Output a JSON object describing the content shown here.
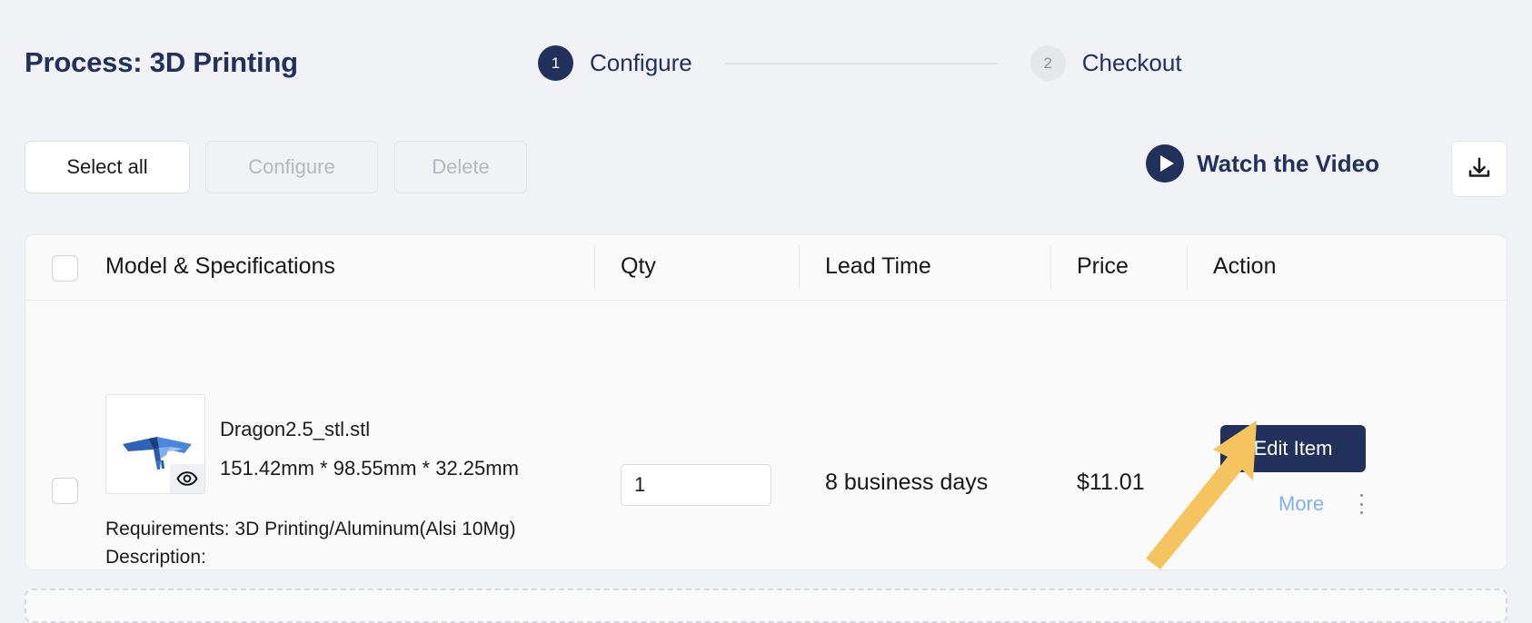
{
  "header": {
    "page_title": "Process: 3D Printing",
    "steps": [
      {
        "number": "1",
        "label": "Configure",
        "state": "active"
      },
      {
        "number": "2",
        "label": "Checkout",
        "state": "idle"
      }
    ]
  },
  "toolbar": {
    "select_all_label": "Select all",
    "configure_label": "Configure",
    "delete_label": "Delete",
    "watch_video_label": "Watch the Video",
    "download_icon": "download-icon",
    "play_icon": "play-icon"
  },
  "table": {
    "columns": [
      "Model & Specifications",
      "Qty",
      "Lead Time",
      "Price",
      "Action"
    ],
    "rows": [
      {
        "file_name": "Dragon2.5_stl.stl",
        "dimensions": "151.42mm * 98.55mm * 32.25mm",
        "requirements": "Requirements: 3D Printing/Aluminum(Alsi 10Mg)",
        "description": "Description:",
        "qty": "1",
        "lead_time": "8 business days",
        "price": "$11.01",
        "edit_label": "Edit Item",
        "more_label": "More",
        "preview_icon": "eye-icon",
        "kebab_icon": "more-vertical-icon",
        "thumbnail": "dragon-3d-model-thumbnail"
      }
    ]
  },
  "colors": {
    "navy": "#22305c",
    "page_bg": "#f0f2f5",
    "card_bg": "#fafafa",
    "link_blue": "#7fb0f0",
    "annotation_yellow": "#f5c45e",
    "disabled_text": "#b4b8bf"
  },
  "annotation": {
    "arrow_icon": "arrow-up-right-annotation"
  }
}
